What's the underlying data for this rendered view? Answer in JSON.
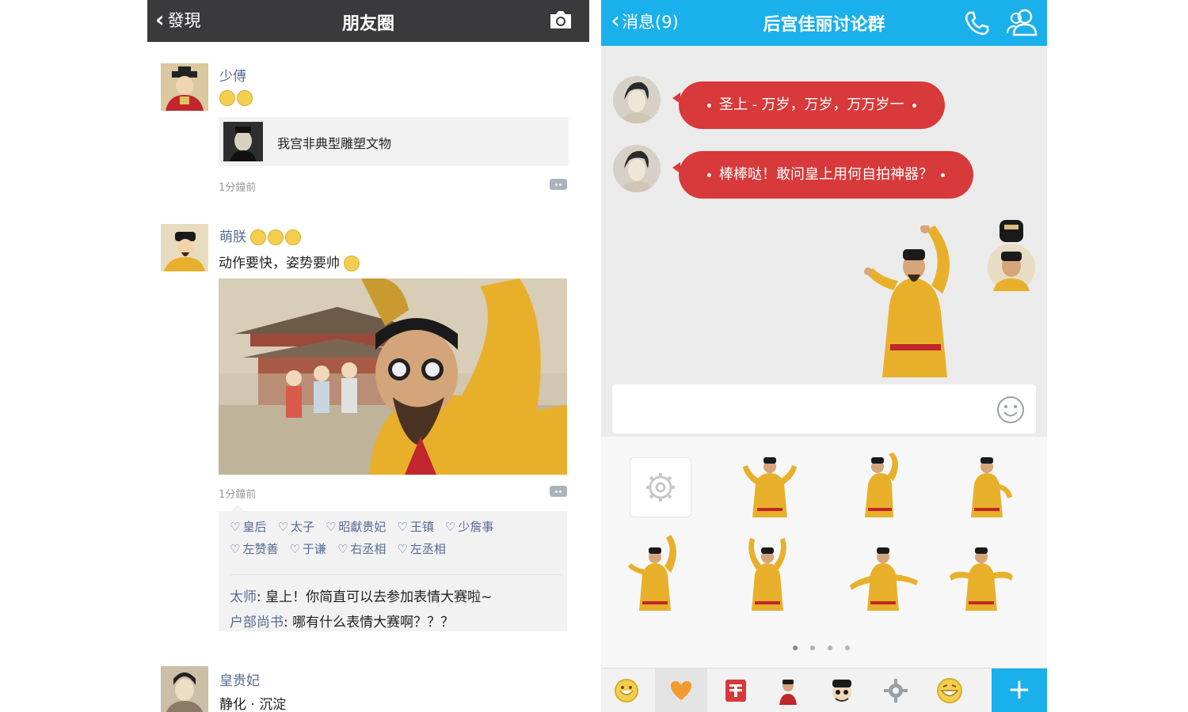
{
  "moments": {
    "back_label": "發現",
    "title": "朋友圈",
    "posts": [
      {
        "author": "少傅",
        "share_title": "我宫非典型雕塑文物",
        "time": "1分鐘前"
      },
      {
        "author": "萌朕",
        "text": "动作要快，姿势要帅",
        "time": "1分鐘前",
        "likes": [
          "皇后",
          "太子",
          "昭獻贵妃",
          "王镇",
          "少詹事",
          "左赞善",
          "于谦",
          "右丞相",
          "左丞相"
        ],
        "comments": [
          {
            "who": "太师",
            "sep": ": ",
            "text": "皇上！你简直可以去参加表情大赛啦~"
          },
          {
            "who": "户部尚书",
            "sep": ": ",
            "text": "哪有什么表情大赛啊？？？"
          }
        ]
      },
      {
        "author": "皇贵妃",
        "text": "静化 · 沉淀"
      }
    ]
  },
  "chat": {
    "back_label": "消息(9)",
    "title": "后宫佳丽讨论群",
    "messages": [
      {
        "text": "圣上 - 万岁，万岁，万万岁一"
      },
      {
        "text": "棒棒哒！敢问皇上用何自拍神器？"
      }
    ],
    "input_placeholder": "",
    "sticker_pages": 4,
    "active_page": 1
  },
  "colors": {
    "moments_bar": "#3a3a3d",
    "qq_blue": "#1ab0ec",
    "bubble_red": "#d8393a",
    "robe_yellow": "#e8b02a",
    "link_blue": "#576b95"
  }
}
